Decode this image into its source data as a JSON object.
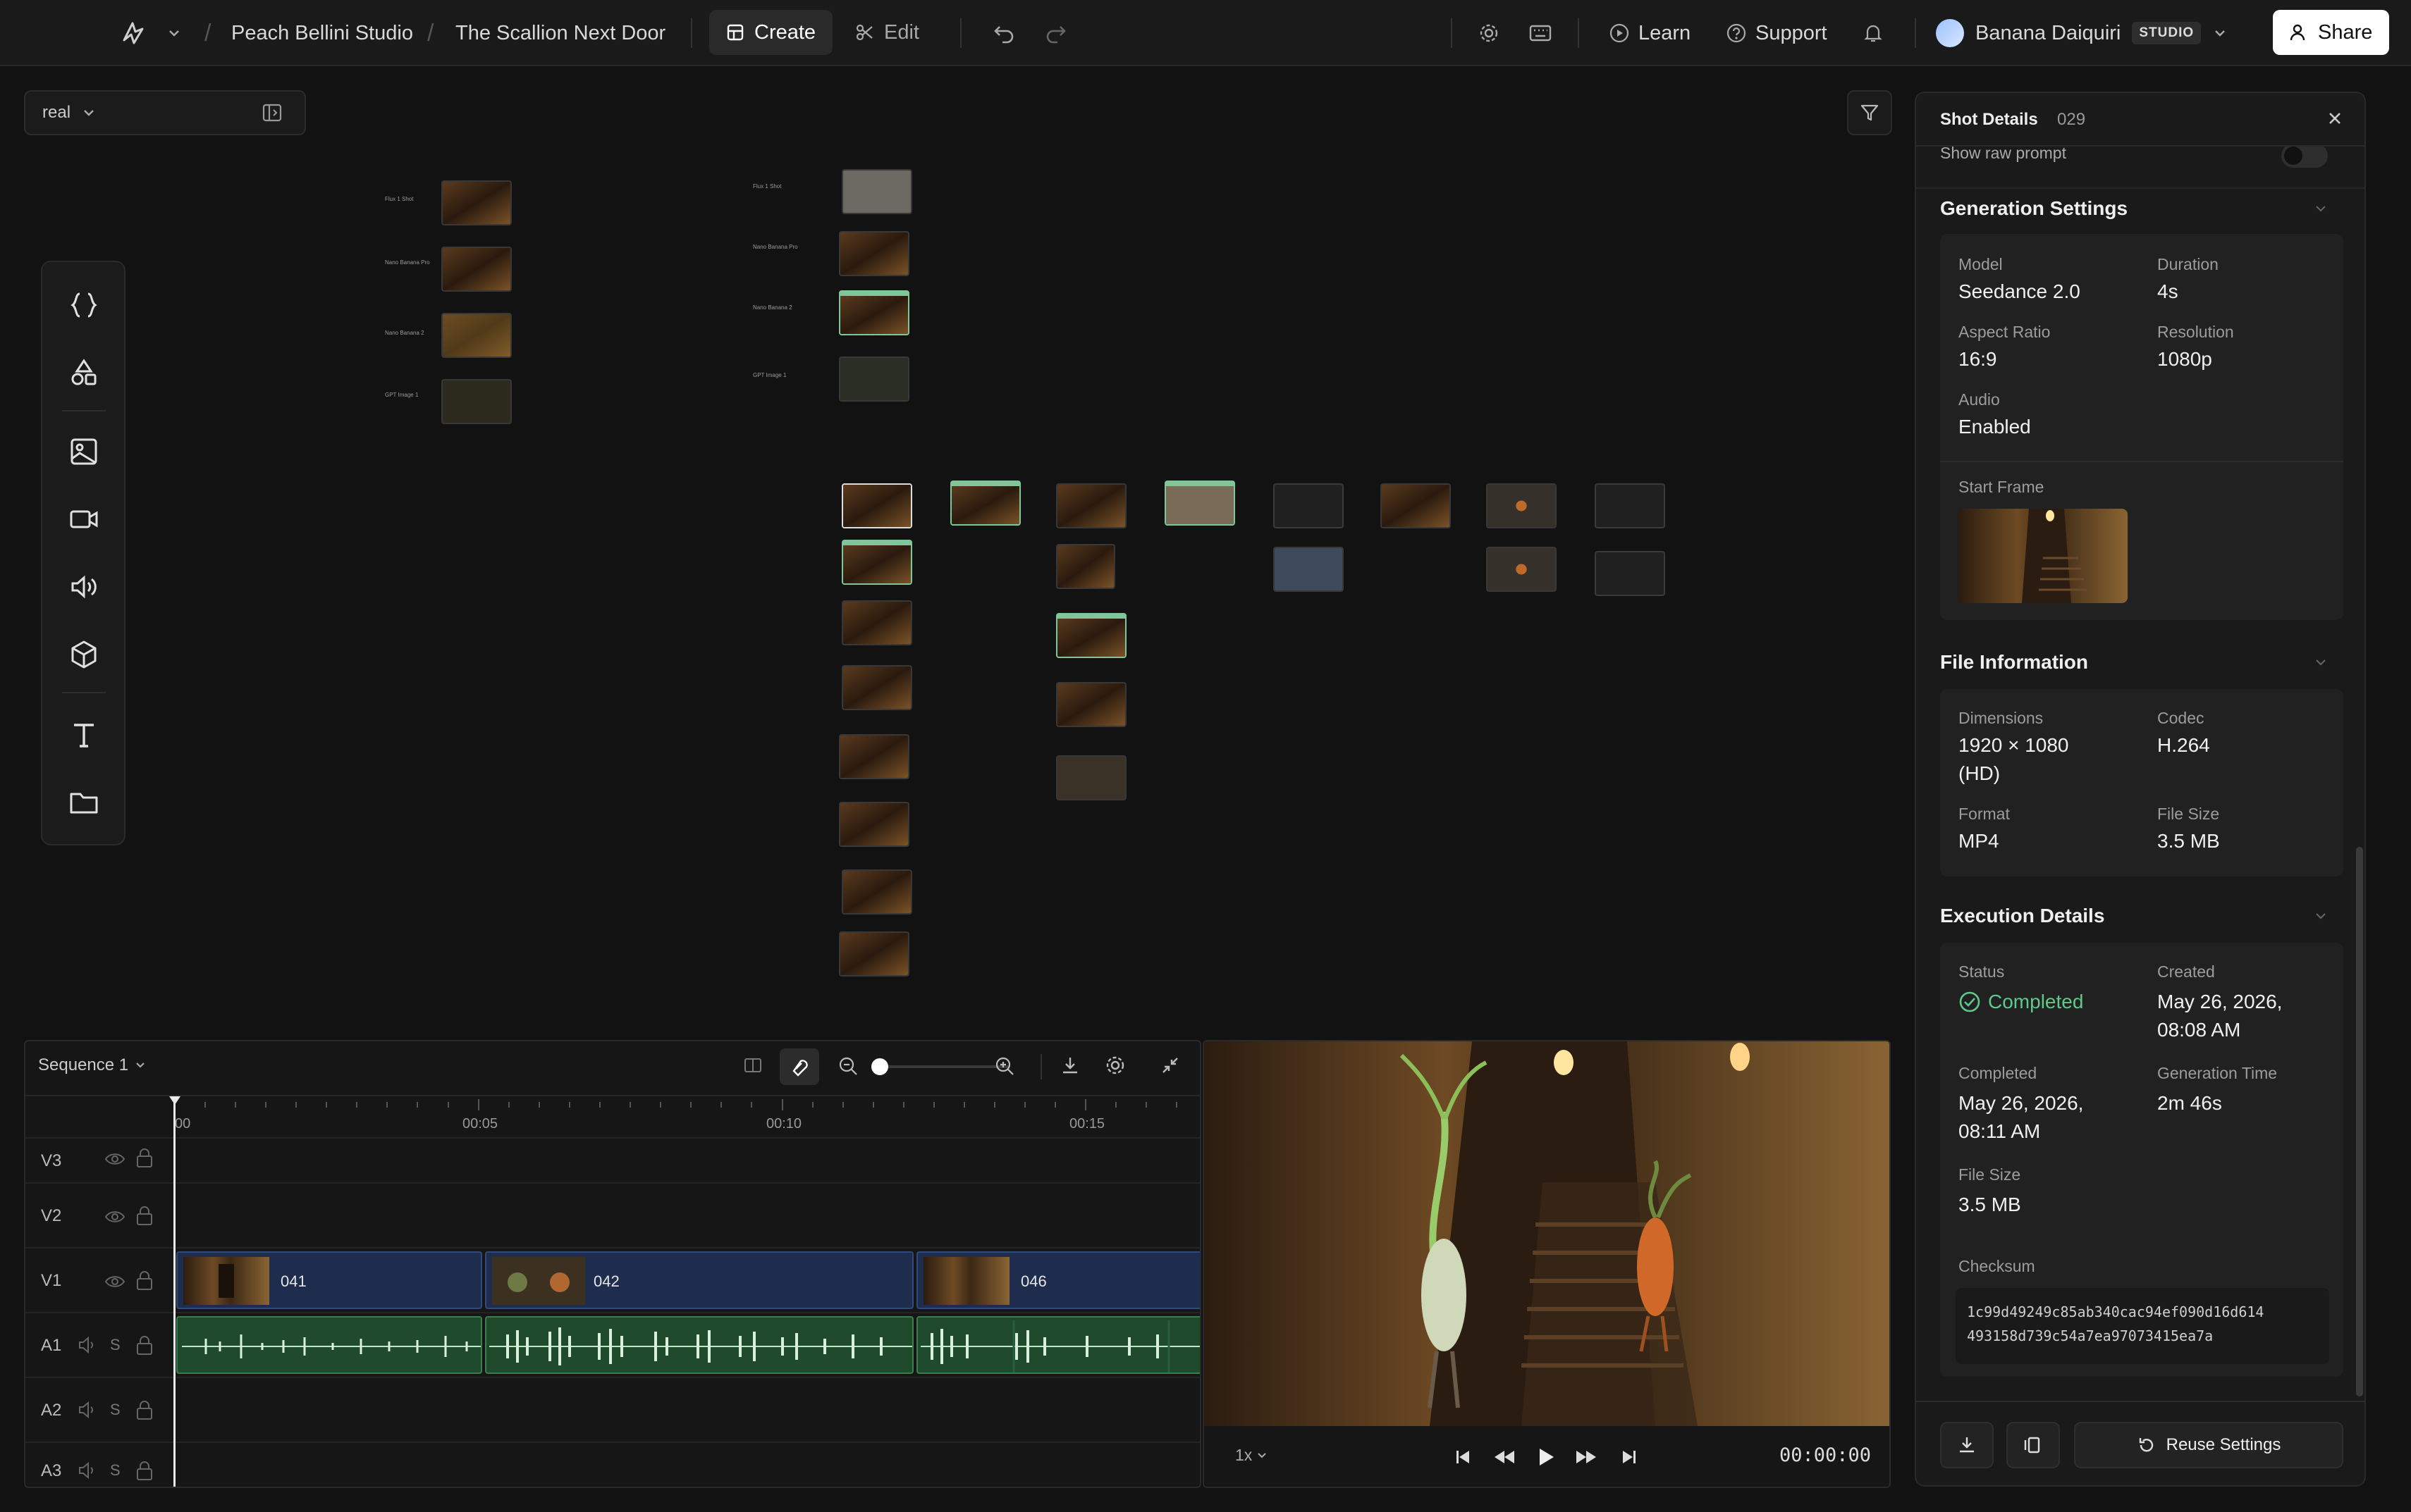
{
  "topbar": {
    "project": "Peach Bellini Studio",
    "scene": "The Scallion Next Door",
    "create_label": "Create",
    "edit_label": "Edit",
    "learn_label": "Learn",
    "support_label": "Support",
    "user_name": "Banana Daiquiri",
    "plan_badge": "STUDIO",
    "share_label": "Share"
  },
  "canvas": {
    "view_select": "real",
    "tiny_labels": [
      "Flux 1 Shot",
      "Nano Banana Pro",
      "Nano Banana 2",
      "GPT Image 1",
      "Flux 1 Shot",
      "Nano Banana Pro",
      "Nano Banana 2",
      "GPT Image 1"
    ]
  },
  "tools": [
    "code-braces-icon",
    "shapes-icon",
    "image-icon",
    "video-icon",
    "audio-icon",
    "cube-icon",
    "text-icon",
    "folder-icon"
  ],
  "timeline": {
    "sequence": "Sequence 1",
    "ticks": [
      "00",
      "00:05",
      "00:10",
      "00:15"
    ],
    "tracks": [
      {
        "id": "V3",
        "type": "video"
      },
      {
        "id": "V2",
        "type": "video"
      },
      {
        "id": "V1",
        "type": "video"
      },
      {
        "id": "A1",
        "type": "audio"
      },
      {
        "id": "A2",
        "type": "audio"
      },
      {
        "id": "A3",
        "type": "audio"
      }
    ],
    "solo_letter": "S",
    "clips": [
      "041",
      "042",
      "046"
    ]
  },
  "preview": {
    "speed": "1x",
    "timecode": "00:00:00"
  },
  "panel": {
    "title": "Shot Details",
    "shot_id": "029",
    "raw_prompt_label": "Show raw prompt",
    "generation": {
      "title": "Generation Settings",
      "model_k": "Model",
      "model_v": "Seedance 2.0",
      "duration_k": "Duration",
      "duration_v": "4s",
      "aspect_k": "Aspect Ratio",
      "aspect_v": "16:9",
      "res_k": "Resolution",
      "res_v": "1080p",
      "audio_k": "Audio",
      "audio_v": "Enabled",
      "start_frame_k": "Start Frame"
    },
    "file": {
      "title": "File Information",
      "dim_k": "Dimensions",
      "dim_v1": "1920 × 1080",
      "dim_v2": "(HD)",
      "codec_k": "Codec",
      "codec_v": "H.264",
      "format_k": "Format",
      "format_v": "MP4",
      "size_k": "File Size",
      "size_v": "3.5 MB"
    },
    "execution": {
      "title": "Execution Details",
      "status_k": "Status",
      "status_v": "Completed",
      "created_k": "Created",
      "created_v1": "May 26, 2026,",
      "created_v2": "08:08 AM",
      "completed_k": "Completed",
      "completed_v1": "May 26, 2026,",
      "completed_v2": "08:11 AM",
      "gentime_k": "Generation Time",
      "gentime_v": "2m 46s",
      "size_k": "File Size",
      "size_v": "3.5 MB",
      "checksum_k": "Checksum",
      "checksum_1": "1c99d49249c85ab340cac94ef090d16d614",
      "checksum_2": "493158d739c54a7ea97073415ea7a"
    },
    "reuse_label": "Reuse Settings"
  },
  "colors": {
    "accent_green": "#5fc98a",
    "clip_blue": "#1e2c4e",
    "audio_green": "#1f4b2c"
  }
}
